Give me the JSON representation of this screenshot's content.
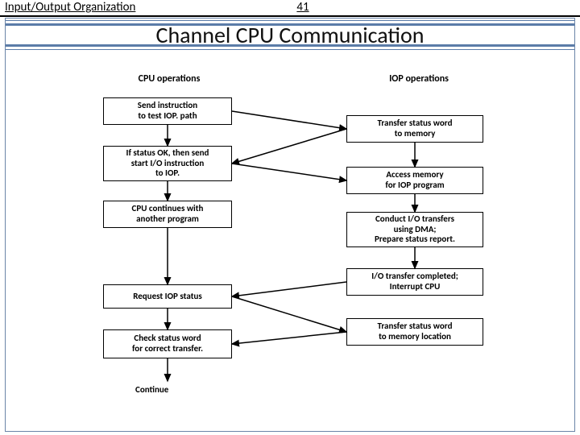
{
  "header": {
    "left": "Input/Output Organization",
    "page": "41"
  },
  "title": "Channel CPU Communication",
  "cols": {
    "left": "CPU operations",
    "right": "IOP operations"
  },
  "cpu": {
    "b1": "Send instruction\nto test IOP. path",
    "b2": "If status OK, then send\nstart I/O instruction\nto IOP.",
    "b3": "CPU continues with\nanother program",
    "b4": "Request IOP status",
    "b5": "Check status word\nfor correct transfer.",
    "cont": "Continue"
  },
  "iop": {
    "b1": "Transfer status word\nto memory",
    "b2": "Access memory\nfor IOP program",
    "b3": "Conduct I/O transfers\nusing DMA;\nPrepare status report.",
    "b4": "I/O transfer completed;\nInterrupt CPU",
    "b5": "Transfer status word\nto memory location"
  }
}
